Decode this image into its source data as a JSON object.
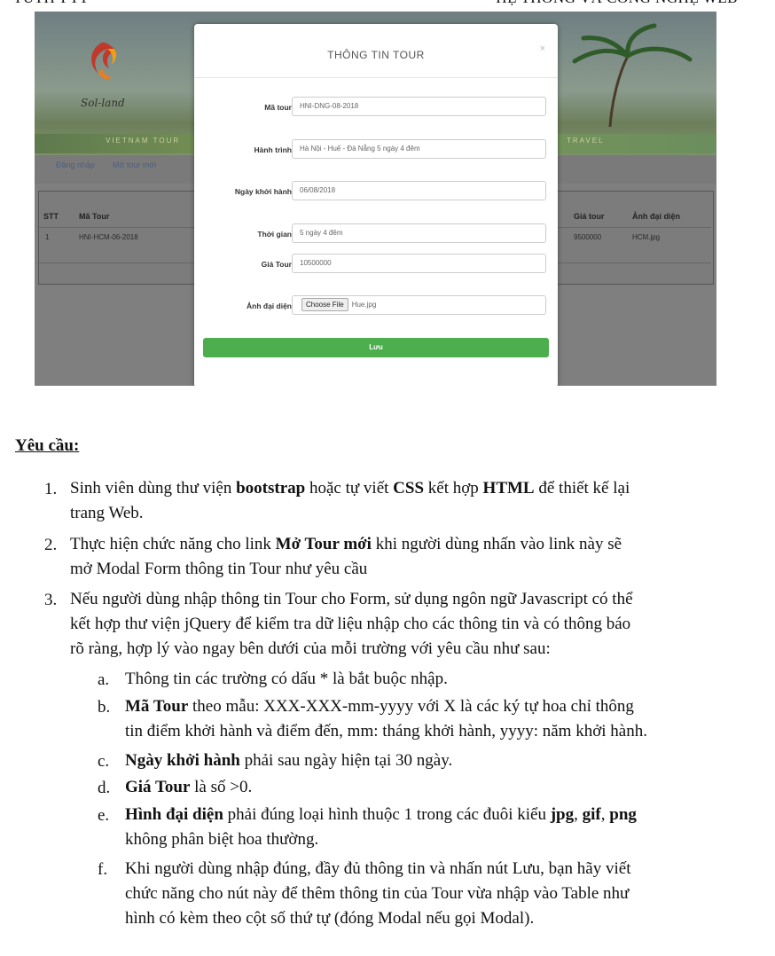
{
  "header": {
    "left": "TUTH-PTT",
    "right": "HỆ THỐNG VÀ CÔNG NGHỆ WEB"
  },
  "screenshot": {
    "logo_text": "Sol-land",
    "strip_left": "VIETNAM TOUR",
    "strip_right": "TRAVEL",
    "nav": [
      "Đăng nhập",
      "Mở tour mới"
    ],
    "table": {
      "headers": [
        "STT",
        "Mã Tour",
        "Giá tour",
        "Ảnh đại diện"
      ],
      "row": [
        "1",
        "HNI-HCM-06-2018",
        "9500000",
        "HCM.jpg"
      ]
    },
    "modal": {
      "title": "THÔNG TIN TOUR",
      "close": "×",
      "fields": [
        {
          "label": "Mã tour",
          "value": "HNI-DNG-08-2018"
        },
        {
          "label": "Hành trình",
          "value": "Hà Nội - Huế - Đà Nẵng 5 ngày 4 đêm"
        },
        {
          "label": "Ngày khởi hành",
          "value": "06/08/2018"
        },
        {
          "label": "Thời gian",
          "value": "5 ngày 4 đêm"
        },
        {
          "label": "Giá Tour",
          "value": "10500000"
        },
        {
          "label": "Ảnh đại diện",
          "file_button": "Choose File",
          "value": "Hue.jpg"
        }
      ],
      "required_mark": "*",
      "save_label": "Lưu"
    }
  },
  "doc": {
    "section_title": "Yêu cầu:",
    "items": [
      {
        "num": "1.",
        "line1": "Sinh viên dùng thư viện <b>bootstrap</b> hoặc tự viết <b>CSS</b> kết hợp <b>HTML</b> để thiết kế lại",
        "line2": "trang Web."
      },
      {
        "num": "2.",
        "line1": "Thực hiện chức năng cho link <b>Mở Tour mới</b> khi người dùng nhấn vào link này sẽ",
        "line2": "mở Modal Form thông tin Tour như yêu cầu"
      },
      {
        "num": "3.",
        "line1": "Nếu người dùng nhập thông tin Tour cho Form, sử dụng ngôn ngữ Javascript có thể",
        "line2": "kết hợp thư viện jQuery để kiểm tra dữ liệu nhập cho các thông tin và có thông báo",
        "line3": "rõ ràng, hợp lý vào ngay bên dưới của mỗi trường với yêu cầu như sau:"
      }
    ],
    "subitems": [
      {
        "num": "a.",
        "line1": "Thông tin các trường có dấu * là bắt buộc nhập."
      },
      {
        "num": "b.",
        "line1": "<b>Mã Tour</b> theo mẫu: XXX-XXX-mm-yyyy với X là các ký tự hoa chỉ thông",
        "line2": "tin điểm khởi hành và điểm đến, mm: tháng khởi hành, yyyy: năm khởi hành."
      },
      {
        "num": "c.",
        "line1": "<b>Ngày khởi hành</b> phải sau ngày hiện tại 30 ngày."
      },
      {
        "num": "d.",
        "line1": "<b>Giá Tour</b> là số &gt;0."
      },
      {
        "num": "e.",
        "line1": "<b>Hình đại diện</b> phải đúng loại hình thuộc 1 trong các đuôi kiểu <b>jpg</b>, <b>gif</b>, <b>png</b>",
        "line2": "không phân biệt hoa thường."
      },
      {
        "num": "f.",
        "line1": "Khi người dùng nhập đúng, đầy đủ thông tin và nhấn nút Lưu, bạn hãy viết",
        "line2": "chức năng cho nút này để thêm thông tin của Tour vừa nhập vào Table như",
        "line3": "hình có kèm theo cột số thứ tự (đóng Modal nếu gọi Modal)."
      }
    ]
  }
}
